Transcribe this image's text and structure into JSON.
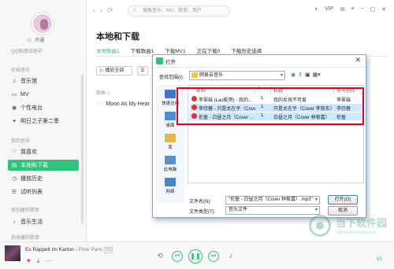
{
  "sidebar": {
    "user_status": "开通",
    "qq_line": "QQ极速加速中",
    "online_music_title": "在线音乐",
    "items_online": [
      {
        "icon": "music-hall-icon",
        "label": "音乐馆"
      },
      {
        "icon": "mv-icon",
        "label": "MV"
      },
      {
        "icon": "radio-icon",
        "label": "个性电台"
      },
      {
        "icon": "star-icon",
        "label": "明日之子第二季"
      }
    ],
    "my_music_title": "我的音乐",
    "items_my": [
      {
        "icon": "heart-icon",
        "label": "我喜欢"
      },
      {
        "icon": "local-download-icon",
        "label": "本地和下载",
        "active": true
      },
      {
        "icon": "history-icon",
        "label": "播放历史"
      },
      {
        "icon": "list-icon",
        "label": "试听列表"
      }
    ],
    "my_created_title": "我创建的歌单",
    "items_created": [
      {
        "icon": "playlist-icon",
        "label": "音乐生活"
      }
    ],
    "my_collected_title": "我收藏的歌单"
  },
  "header": {
    "search_placeholder": "搜索音乐、MV、歌单、用户",
    "icons": [
      "skin-icon",
      "vip-icon",
      "mail-icon",
      "settings-icon",
      "minimize-icon",
      "maximize-icon",
      "close-icon"
    ],
    "vip_label": "VIP"
  },
  "main": {
    "title": "本地和下载",
    "tabs": [
      {
        "label": "本地歌曲1",
        "active": true
      },
      {
        "label": "下载歌曲1"
      },
      {
        "label": "下载MV1"
      },
      {
        "label": "正在下载0"
      },
      {
        "label": "下载历史选择"
      }
    ],
    "play_all_label": "播放全部",
    "col_song": "歌曲 ◇",
    "songs": [
      {
        "title": "Moon As My Hear"
      }
    ]
  },
  "dialog": {
    "title": "打开",
    "look_in_label": "查找范围(I):",
    "look_in_value": "网易云音乐",
    "places": [
      {
        "icon": "quick-access-icon",
        "label": "快速访问",
        "color": "#3a77c8"
      },
      {
        "icon": "desktop-icon",
        "label": "桌面",
        "color": "#4a8fd6"
      },
      {
        "icon": "library-icon",
        "label": "库",
        "color": "#e3b74b"
      },
      {
        "icon": "this-pc-icon",
        "label": "此电脑",
        "color": "#5a8ec9"
      },
      {
        "icon": "network-icon",
        "label": "网络",
        "color": "#4a86c4"
      }
    ],
    "columns": [
      "名称",
      "#",
      "标题",
      "参与创作"
    ],
    "files": [
      {
        "name": "李翠菇 (Lao乾哥) - 我的...",
        "num": "1",
        "title": "我的女孩不可爱",
        "artist": "李翠菇"
      },
      {
        "name": "李欣蓉 - 只是太在乎（Cove...",
        "num": "1",
        "title": "只是太在乎（Cover 李晓东）",
        "artist": "李欣蓉",
        "selected": true
      },
      {
        "name": "伦盈 - 白昼之月（Cover ...",
        "num": "1",
        "title": "白昼之月（Cover 林宥嘉）",
        "artist": "伦盈",
        "selected": true
      }
    ],
    "filename_label": "文件名(N):",
    "filename_value": "\"伦盈 - 白昼之月（Cover 林宥嘉）.mp3\"",
    "filetype_label": "文件类型(T):",
    "filetype_value": "音乐文件",
    "open_label": "打开(O)",
    "cancel_label": "取消"
  },
  "player": {
    "song": "Es Rappelt Im Karton",
    "artist": "Pixie Paris",
    "quality": "SQ",
    "volume": "53"
  },
  "watermark": {
    "title": "当下软件园",
    "subtitle": "www.downxia.com"
  }
}
